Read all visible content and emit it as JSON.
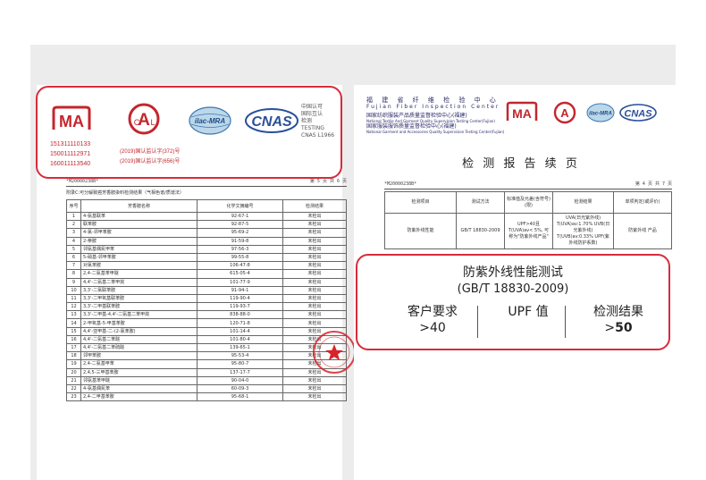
{
  "left_page": {
    "cert_numbers": [
      "151311110133",
      "150011112971",
      "160011113540"
    ],
    "accreditations": [
      "(2019)国认监认字(372)号",
      "(2019)国认监认字(656)号"
    ],
    "ma_logo_text": "MA",
    "cal_logo_text": "CAL",
    "ilac_logo_text": "ilac-MRA",
    "cnas_logo_text": "CNAS",
    "cnas_lines": [
      "中国认可",
      "国际互认",
      "检测",
      "TESTING",
      "CNAS L1966"
    ],
    "report_no": "*M20000238B*",
    "page_no": "第 5 页 共 6 页",
    "table_title": "附录C:可分解致癌芳香胺染料检测结果（气相色谱/质谱法）",
    "headers": [
      "序号",
      "芳香胺名称",
      "化学文摘编号",
      "检测结果"
    ],
    "rows": [
      [
        "1",
        "4-氨基联苯",
        "92-67-1",
        "未检出"
      ],
      [
        "2",
        "联苯胺",
        "92-87-5",
        "未检出"
      ],
      [
        "3",
        "4-氯-邻甲苯胺",
        "95-69-2",
        "未检出"
      ],
      [
        "4",
        "2-萘胺",
        "91-59-8",
        "未检出"
      ],
      [
        "5",
        "邻氨基偶氮甲苯",
        "97-56-3",
        "未检出"
      ],
      [
        "6",
        "5-硝基-邻甲苯胺",
        "99-55-8",
        "未检出"
      ],
      [
        "7",
        "对氯苯胺",
        "106-47-8",
        "未检出"
      ],
      [
        "8",
        "2,4-二氨基苯甲醚",
        "615-05-4",
        "未检出"
      ],
      [
        "9",
        "4,4'-二氨基二苯甲烷",
        "101-77-9",
        "未检出"
      ],
      [
        "10",
        "3,3'-二氯联苯胺",
        "91-94-1",
        "未检出"
      ],
      [
        "11",
        "3,3'-二甲氧基联苯胺",
        "119-90-4",
        "未检出"
      ],
      [
        "12",
        "3,3'-二甲基联苯胺",
        "119-93-7",
        "未检出"
      ],
      [
        "13",
        "3,3'-二甲基-4,4'-二氨基二苯甲烷",
        "838-88-0",
        "未检出"
      ],
      [
        "14",
        "2-甲氧基-5-甲基苯胺",
        "120-71-8",
        "未检出"
      ],
      [
        "15",
        "4,4'-亚甲基-二-(2-氯苯胺)",
        "101-14-4",
        "未检出"
      ],
      [
        "16",
        "4,4'-二氨基二苯醚",
        "101-80-4",
        "未检出"
      ],
      [
        "17",
        "4,4'-二氨基二苯硫醚",
        "139-65-1",
        "未检出"
      ],
      [
        "18",
        "邻甲苯胺",
        "95-53-4",
        "未检出"
      ],
      [
        "19",
        "2,4-二氨基甲苯",
        "95-80-7",
        "未检出"
      ],
      [
        "20",
        "2,4,5-三甲基苯胺",
        "137-17-7",
        "未检出"
      ],
      [
        "21",
        "邻氨基苯甲醚",
        "90-04-0",
        "未检出"
      ],
      [
        "22",
        "4-氨基偶氮苯",
        "60-09-3",
        "未检出"
      ],
      [
        "23",
        "2,4-二甲基苯胺",
        "95-68-1",
        "未检出"
      ]
    ]
  },
  "right_page": {
    "header_cn_spaced": "福 建 省 纤 维 检 验 中 心",
    "header_en": "Fujian  Fiber  Inspection  Center",
    "header_line2": "国家纺织服装产品质量监督检验中心(福建)",
    "header_line2_en": "National Textile And Garment Quality Supervision Testing Center(Fujian)",
    "header_line3": "国家服装服饰质量监督检验中心(福建)",
    "header_line3_en": "National Garment and Accessories Quality Supervision Testing Center(Fujian)",
    "title": "检 测 报 告 续 页",
    "report_no": "*M20000238B*",
    "page_no": "第 4 页 共 7 页",
    "headers": [
      "检测项目",
      "测试方法",
      "标准值及允差(含符号)(限)",
      "检测结果",
      "单项判定(或评价)"
    ],
    "row": {
      "item": "防紫外线性能",
      "method": "GB/T 18830-2009",
      "standard": "UPF>40且 T(UVA)av< 5%, 可称为\"防紫外线产品\"",
      "result": "UVA(日光紫外线) T(UVA)av:1.70% UVB(日光紫外线) T(UVB)av:0.33% UPF(紫外线防护系数)",
      "judgement": "防紫外线 产品"
    }
  },
  "highlight": {
    "title": "防紫外线性能测试",
    "standard": "(GB/T 18830-2009)",
    "col1_label": "客户要求",
    "col1_value": ">40",
    "col2_label": "",
    "col2_value": "UPF 值",
    "col3_label": "检测结果",
    "col3_prefix": ">",
    "col3_value": "50"
  },
  "colors": {
    "highlight_border": "#d62c3c",
    "stamp_red": "#d8232a",
    "logo_blue": "#2a4f9a"
  }
}
